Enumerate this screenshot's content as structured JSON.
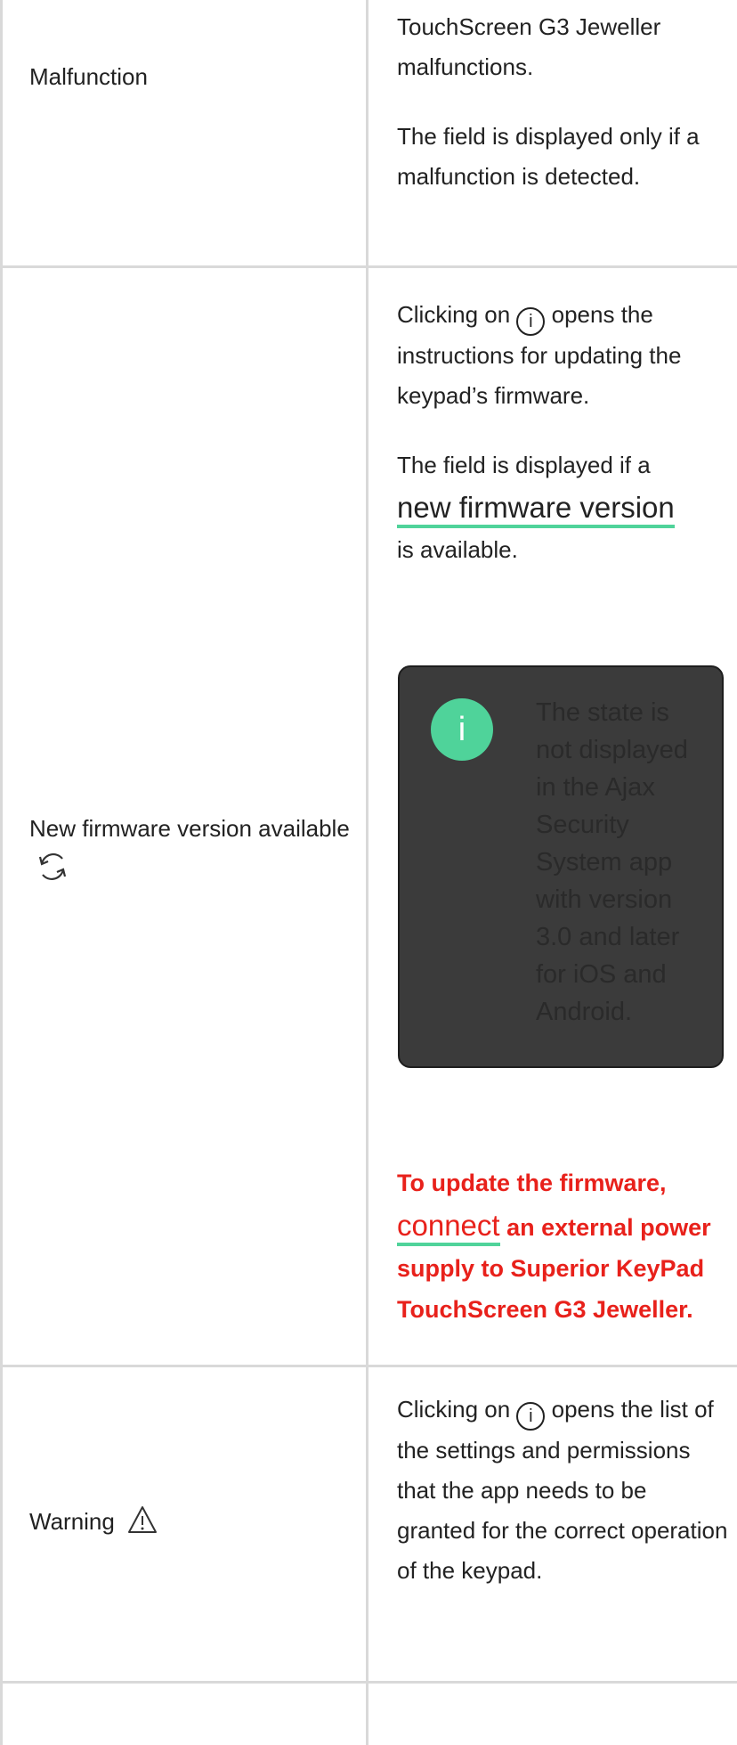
{
  "rows": [
    {
      "label": "Malfunction",
      "description": [
        "TouchScreen G3 Jeweller malfunctions.",
        "The field is displayed only if a malfunction is detected."
      ]
    },
    {
      "label": "New firmware version available",
      "icon": "refresh-icon",
      "description_p1_before": "Clicking on",
      "description_p1_after": "opens the instructions for updating the keypad’s firmware.",
      "description_p2_before": "The field is displayed if a",
      "description_p2_link": "new firmware version",
      "description_p2_after": "is available.",
      "note": {
        "icon": "info-icon",
        "icon_glyph": "i",
        "text": "The state is not displayed in the Ajax Security System app with version 3.0 and later for iOS and Android."
      },
      "warning": {
        "before": "To update the firmware,",
        "link": "connect",
        "after": "an external power supply to Superior KeyPad TouchScreen G3 Jeweller."
      }
    },
    {
      "label": "Warning",
      "icon": "warning-icon",
      "description_before": "Clicking on",
      "description_after": "opens the list of the settings and permissions that the app needs to be granted for the correct operation of the keypad."
    }
  ],
  "info_glyph": "i",
  "colors": {
    "accent_green": "#4fd39a",
    "warning_red": "#e8211b",
    "note_bg": "#3b3b3b",
    "grid": "#d9d9d9"
  }
}
